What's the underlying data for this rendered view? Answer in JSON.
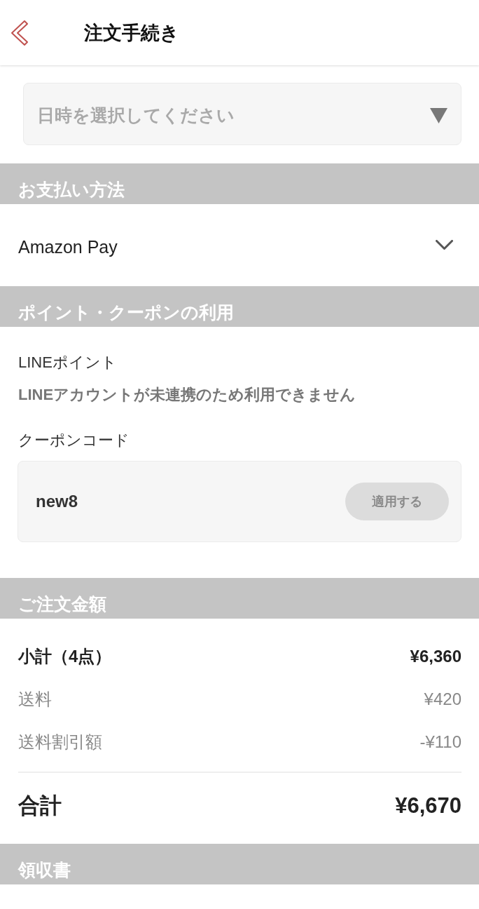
{
  "header": {
    "title": "注文手続き"
  },
  "datetime_select": {
    "placeholder": "日時を選択してください"
  },
  "payment": {
    "heading": "お支払い方法",
    "method": "Amazon Pay"
  },
  "points_coupons": {
    "heading": "ポイント・クーポンの利用",
    "line_points_label": "LINEポイント",
    "line_points_notice": "LINEアカウントが未連携のため利用できません",
    "coupon_label": "クーポンコード",
    "coupon_code": "new8",
    "apply_button": {
      "label": "適用する",
      "disabled": true
    }
  },
  "order_amount": {
    "heading": "ご注文金額",
    "rows": [
      {
        "kind": "subtotal",
        "label": "小計（4点）",
        "amount": "¥6,360"
      },
      {
        "kind": "fee",
        "label": "送料",
        "amount": "¥420"
      },
      {
        "kind": "fee",
        "label": "送料割引額",
        "amount": "-¥110"
      },
      {
        "kind": "total",
        "label": "合計",
        "amount": "¥6,670"
      }
    ]
  },
  "receipt": {
    "heading": "領収書"
  }
}
